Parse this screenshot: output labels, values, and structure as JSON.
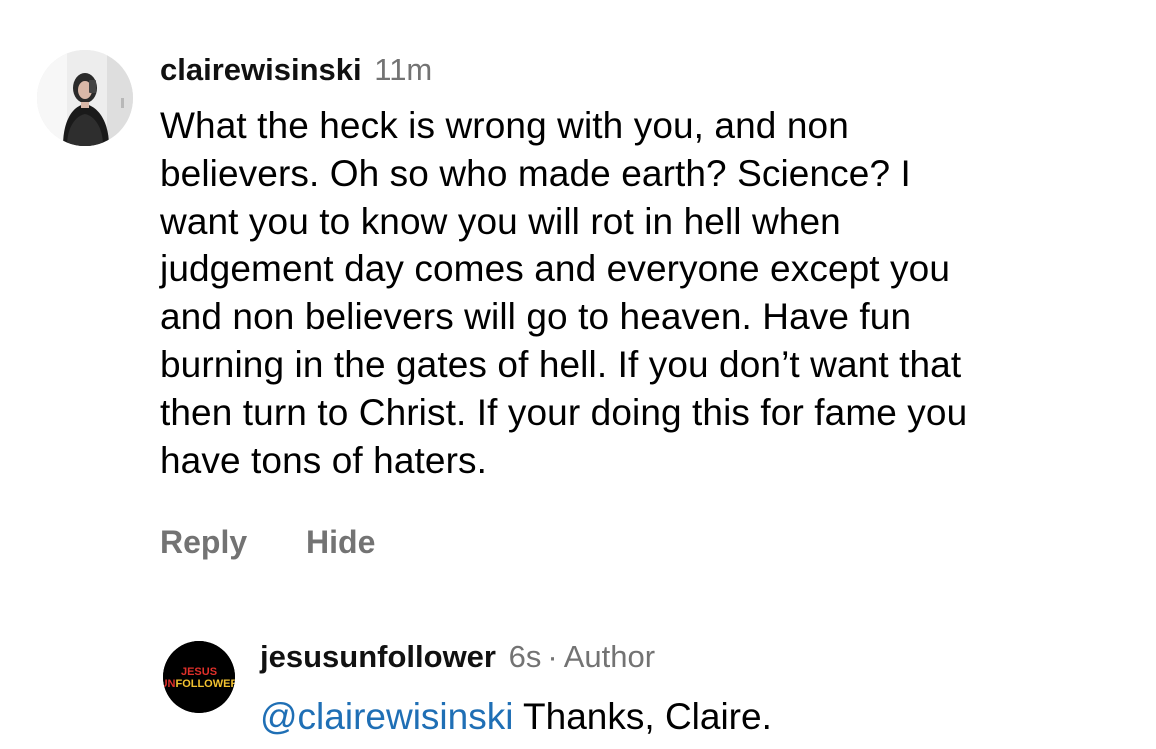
{
  "comment": {
    "username": "clairewisinski",
    "time": "11m",
    "text": "What the heck is wrong with you, and non\nbelievers. Oh so who made earth? Science? I\nwant you to know you will rot in hell when\njudgement day comes and everyone except you\nand non believers will go to heaven. Have fun\nburning in the gates of hell. If you don’t want that\nthen turn to Christ. If your doing this for fame you\nhave tons of haters.",
    "reply_label": "Reply",
    "hide_label": "Hide",
    "avatar_icon": "profile-photo"
  },
  "reply": {
    "username": "jesusunfollower",
    "time": "6s",
    "separator": "·",
    "author_tag": "Author",
    "mention": "@clairewisinski",
    "text": " Thanks, Claire.",
    "avatar_logo_line1": "JESUS",
    "avatar_logo_line2_red": "UN",
    "avatar_logo_line2_yellow": "FOLLOWER"
  },
  "colors": {
    "secondary_text": "#737373",
    "mention": "#1f6fb5",
    "logo_red": "#e0302a",
    "logo_yellow": "#f2c230"
  }
}
